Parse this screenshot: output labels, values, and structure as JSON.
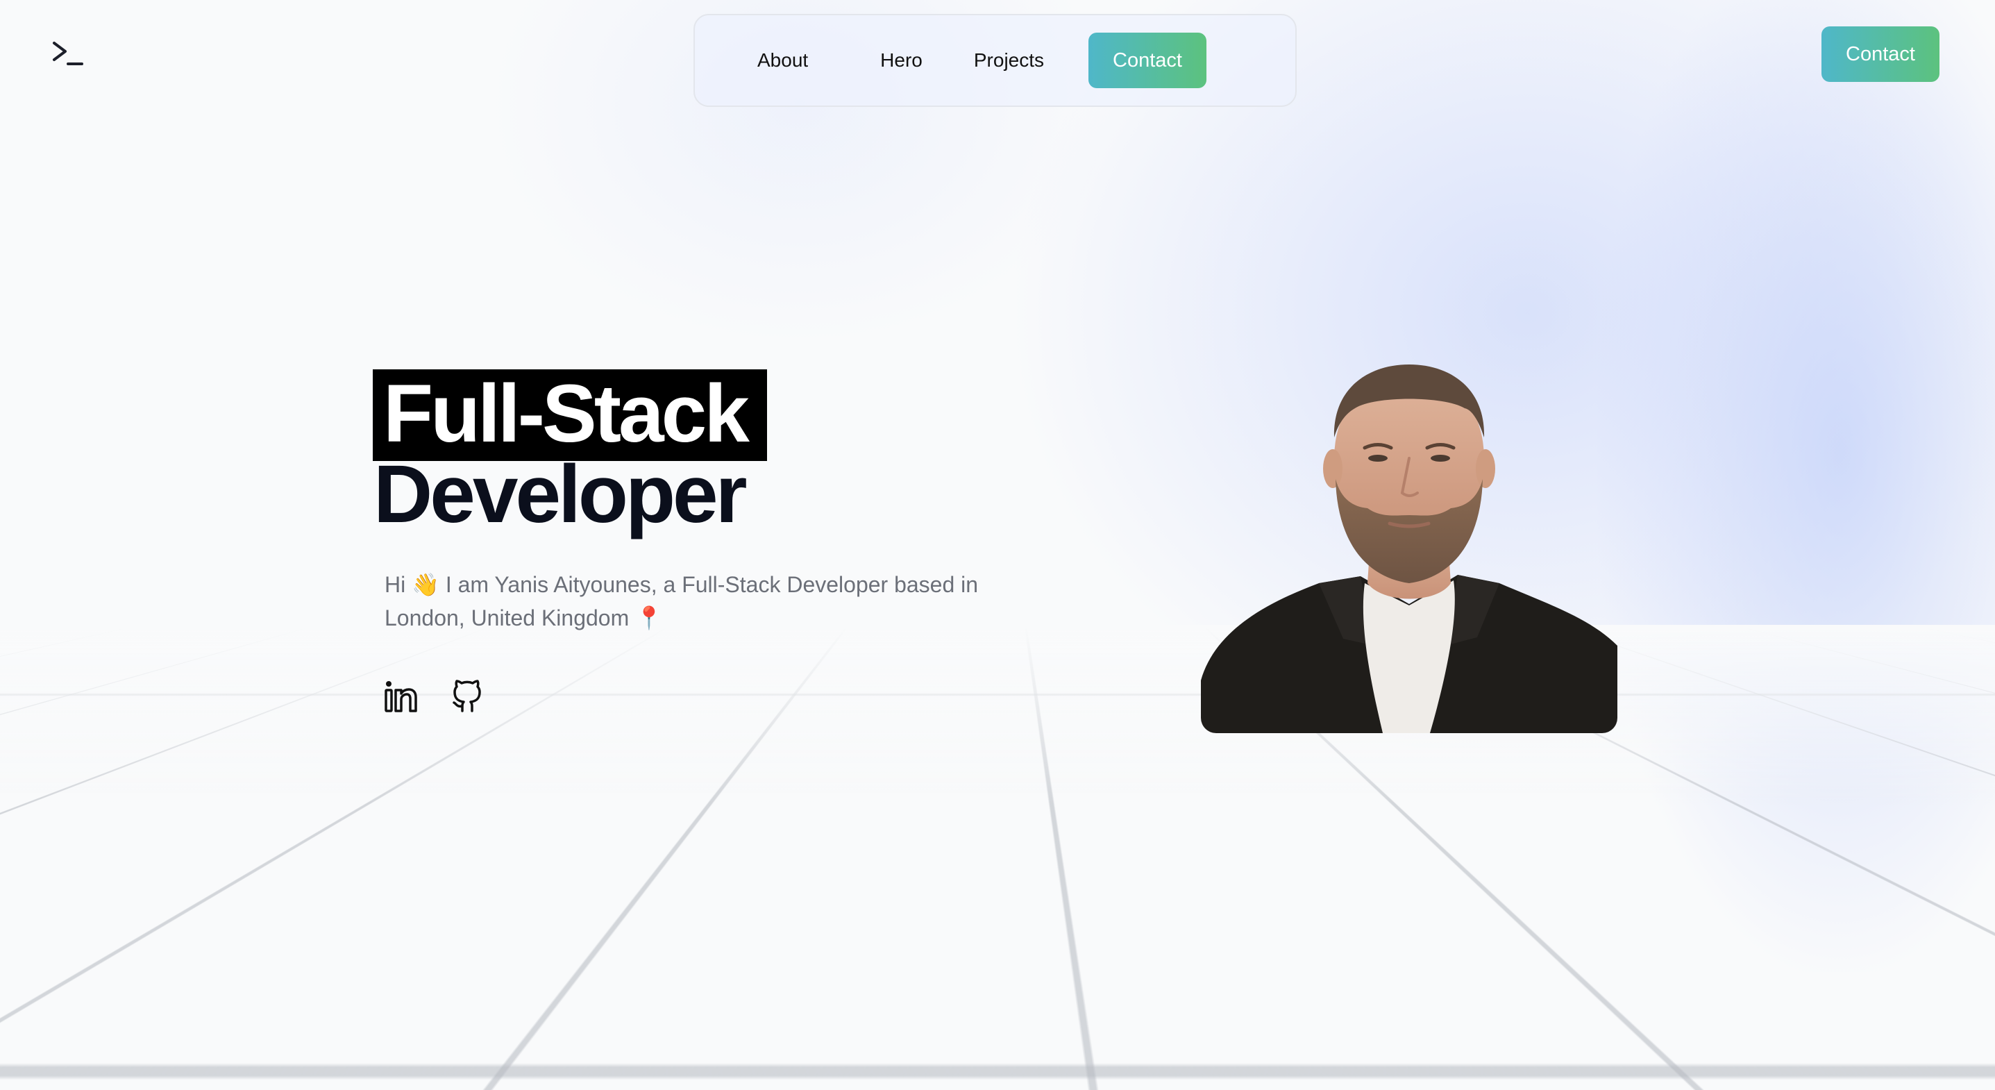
{
  "logo": {
    "icon": "terminal-prompt-icon",
    "text": ">_"
  },
  "nav": {
    "links": [
      "About",
      "Hero",
      "Projects"
    ],
    "contact_label": "Contact"
  },
  "header": {
    "contact_label": "Contact"
  },
  "hero": {
    "title_line1": "Full-Stack",
    "title_line2": "Developer",
    "intro": "Hi 👋 I am Yanis Aityounes, a Full-Stack Developer based in London, United Kingdom 📍",
    "social": [
      {
        "name": "LinkedIn",
        "icon": "linkedin-icon"
      },
      {
        "name": "GitHub",
        "icon": "github-icon"
      }
    ]
  },
  "colors": {
    "accent_start": "#4fb7c9",
    "accent_end": "#5cc27e",
    "heading": "#0b0f1c",
    "body_text": "#6b6f78"
  }
}
